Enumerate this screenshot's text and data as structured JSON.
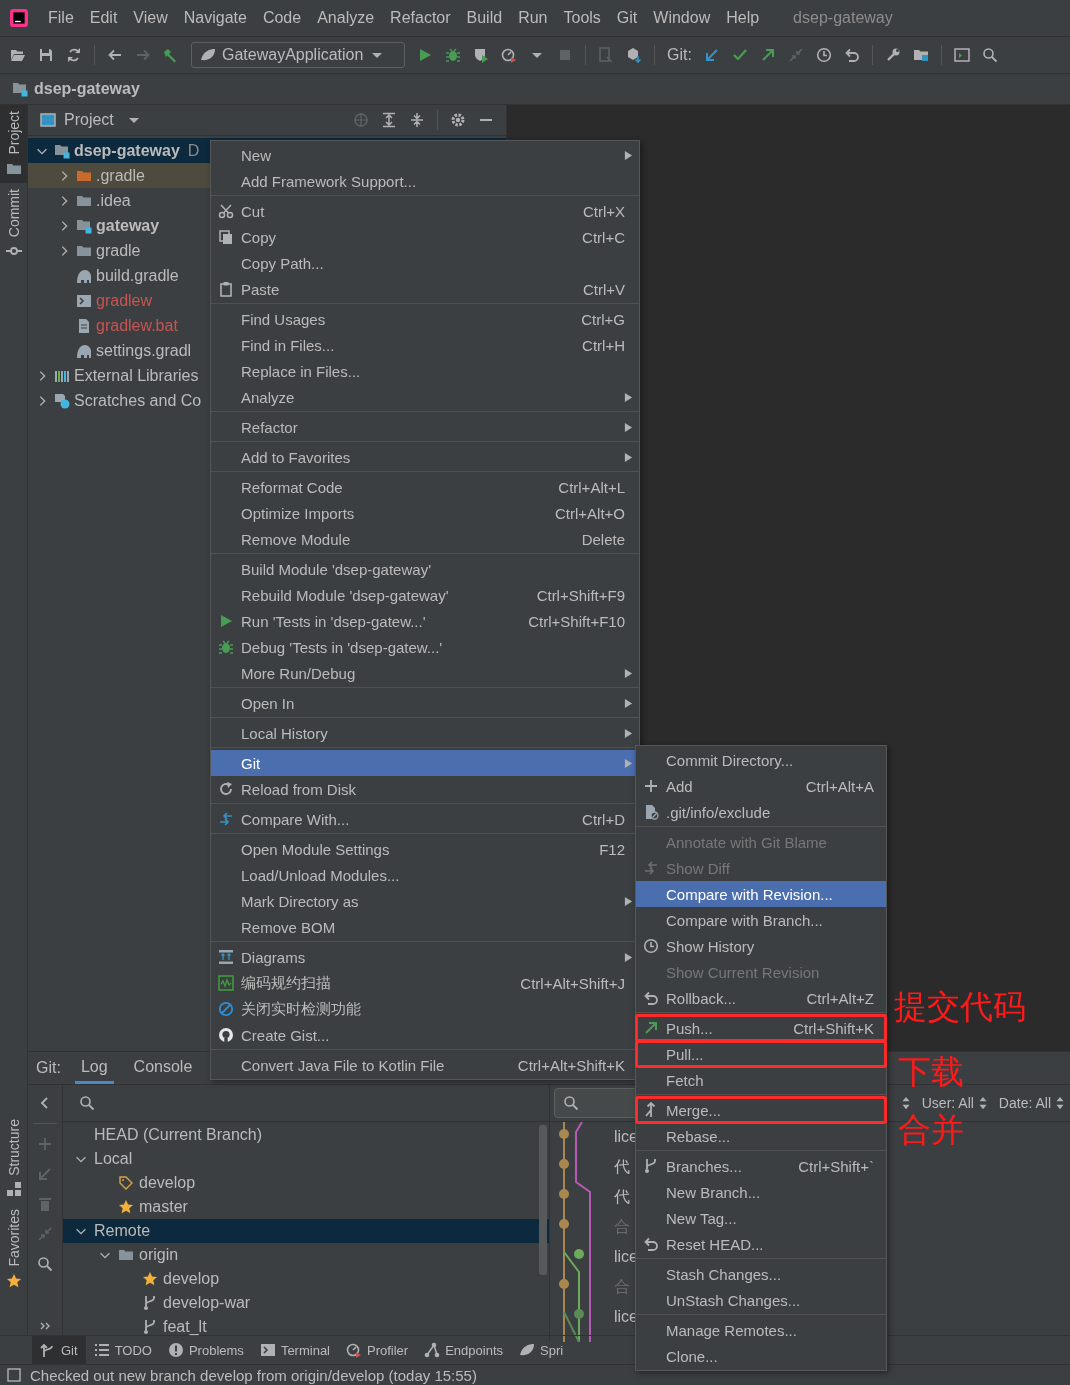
{
  "menu_bar": {
    "items": [
      "File",
      "Edit",
      "View",
      "Navigate",
      "Code",
      "Analyze",
      "Refactor",
      "Build",
      "Run",
      "Tools",
      "Git",
      "Window",
      "Help"
    ],
    "project_title": "dsep-gateway"
  },
  "toolbar": {
    "run_config": "GatewayApplication",
    "git_label": "Git:"
  },
  "nav_bar": {
    "project": "dsep-gateway"
  },
  "left_tabs_top": [
    {
      "label": "Project",
      "selected": true
    },
    {
      "label": "Commit",
      "selected": false
    }
  ],
  "left_tabs_bottom": [
    {
      "label": "Structure",
      "selected": false
    },
    {
      "label": "Favorites",
      "selected": false
    }
  ],
  "project_panel": {
    "title": "Project",
    "tree": [
      {
        "label": "dsep-gateway",
        "suffix": "D",
        "kind": "module",
        "bold": true,
        "expanded": true,
        "selected": true,
        "children": [
          {
            "label": ".gradle",
            "kind": "folder-orange",
            "expanded": false,
            "ignored": true
          },
          {
            "label": ".idea",
            "kind": "folder",
            "expanded": false
          },
          {
            "label": "gateway",
            "kind": "module",
            "bold": true,
            "expanded": false
          },
          {
            "label": "gradle",
            "kind": "folder",
            "expanded": false
          },
          {
            "label": "build.gradle",
            "kind": "gradle"
          },
          {
            "label": "gradlew",
            "kind": "script",
            "untracked": true
          },
          {
            "label": "gradlew.bat",
            "kind": "file",
            "untracked": true
          },
          {
            "label": "settings.gradl",
            "kind": "gradle"
          }
        ]
      },
      {
        "label": "External Libraries",
        "kind": "libraries",
        "expanded": false
      },
      {
        "label": "Scratches and Co",
        "kind": "scratches",
        "expanded": false
      }
    ]
  },
  "context_menu": {
    "groups": [
      [
        {
          "label": "New",
          "submenu": true,
          "selected": false
        },
        {
          "label": "Add Framework Support...",
          "selected": false
        }
      ],
      [
        {
          "label": "Cut",
          "shortcut": "Ctrl+X",
          "selected": false
        },
        {
          "label": "Copy",
          "shortcut": "Ctrl+C",
          "selected": false
        },
        {
          "label": "Copy Path...",
          "selected": false
        },
        {
          "label": "Paste",
          "shortcut": "Ctrl+V",
          "selected": false
        }
      ],
      [
        {
          "label": "Find Usages",
          "shortcut": "Ctrl+G",
          "selected": false
        },
        {
          "label": "Find in Files...",
          "shortcut": "Ctrl+H",
          "selected": false
        },
        {
          "label": "Replace in Files...",
          "selected": false
        },
        {
          "label": "Analyze",
          "submenu": true,
          "selected": false
        }
      ],
      [
        {
          "label": "Refactor",
          "submenu": true,
          "selected": false
        }
      ],
      [
        {
          "label": "Add to Favorites",
          "submenu": true,
          "selected": false
        }
      ],
      [
        {
          "label": "Reformat Code",
          "shortcut": "Ctrl+Alt+L",
          "selected": false
        },
        {
          "label": "Optimize Imports",
          "shortcut": "Ctrl+Alt+O",
          "selected": false
        },
        {
          "label": "Remove Module",
          "shortcut": "Delete",
          "selected": false
        }
      ],
      [
        {
          "label": "Build Module 'dsep-gateway'",
          "selected": false
        },
        {
          "label": "Rebuild Module 'dsep-gateway'",
          "shortcut": "Ctrl+Shift+F9",
          "selected": false
        },
        {
          "label": "Run 'Tests in 'dsep-gatew...'",
          "shortcut": "Ctrl+Shift+F10",
          "selected": false
        },
        {
          "label": "Debug 'Tests in 'dsep-gatew...'",
          "selected": false
        },
        {
          "label": "More Run/Debug",
          "submenu": true,
          "selected": false
        }
      ],
      [
        {
          "label": "Open In",
          "submenu": true,
          "selected": false
        }
      ],
      [
        {
          "label": "Local History",
          "submenu": true,
          "selected": false
        }
      ],
      [
        {
          "label": "Git",
          "submenu": true,
          "selected": true
        },
        {
          "label": "Reload from Disk",
          "selected": false
        }
      ],
      [
        {
          "label": "Compare With...",
          "shortcut": "Ctrl+D",
          "selected": false
        }
      ],
      [
        {
          "label": "Open Module Settings",
          "shortcut": "F12",
          "selected": false
        },
        {
          "label": "Load/Unload Modules...",
          "selected": false
        },
        {
          "label": "Mark Directory as",
          "submenu": true,
          "selected": false
        },
        {
          "label": "Remove BOM",
          "selected": false
        }
      ],
      [
        {
          "label": "Diagrams",
          "submenu": true,
          "selected": false
        },
        {
          "label": "编码规约扫描",
          "shortcut": "Ctrl+Alt+Shift+J",
          "selected": false
        },
        {
          "label": "关闭实时检测功能",
          "selected": false
        },
        {
          "label": "Create Gist...",
          "selected": false
        }
      ],
      [
        {
          "label": "Convert Java File to Kotlin File",
          "shortcut": "Ctrl+Alt+Shift+K",
          "selected": false
        }
      ]
    ]
  },
  "git_submenu": {
    "groups": [
      [
        {
          "label": "Commit Directory...",
          "selected": false,
          "disabled": false,
          "highlighted": false
        },
        {
          "label": "Add",
          "shortcut": "Ctrl+Alt+A",
          "selected": false,
          "disabled": false,
          "highlighted": false
        },
        {
          "label": ".git/info/exclude",
          "selected": false,
          "disabled": false,
          "highlighted": false
        }
      ],
      [
        {
          "label": "Annotate with Git Blame",
          "selected": false,
          "disabled": true,
          "highlighted": false
        },
        {
          "label": "Show Diff",
          "selected": false,
          "disabled": true,
          "highlighted": false
        },
        {
          "label": "Compare with Revision...",
          "selected": true,
          "disabled": false,
          "highlighted": false
        },
        {
          "label": "Compare with Branch...",
          "selected": false,
          "disabled": false,
          "highlighted": false
        },
        {
          "label": "Show History",
          "selected": false,
          "disabled": false,
          "highlighted": false
        },
        {
          "label": "Show Current Revision",
          "selected": false,
          "disabled": true,
          "highlighted": false
        },
        {
          "label": "Rollback...",
          "shortcut": "Ctrl+Alt+Z",
          "selected": false,
          "disabled": false,
          "highlighted": false
        }
      ],
      [
        {
          "label": "Push...",
          "shortcut": "Ctrl+Shift+K",
          "selected": false,
          "disabled": false,
          "highlighted": true
        },
        {
          "label": "Pull...",
          "selected": false,
          "disabled": false,
          "highlighted": true
        },
        {
          "label": "Fetch",
          "selected": false,
          "disabled": false,
          "highlighted": false
        }
      ],
      [
        {
          "label": "Merge...",
          "selected": false,
          "disabled": false,
          "highlighted": true
        },
        {
          "label": "Rebase...",
          "selected": false,
          "disabled": false,
          "highlighted": false
        }
      ],
      [
        {
          "label": "Branches...",
          "shortcut": "Ctrl+Shift+`",
          "selected": false,
          "disabled": false,
          "highlighted": false
        },
        {
          "label": "New Branch...",
          "selected": false,
          "disabled": false,
          "highlighted": false
        },
        {
          "label": "New Tag...",
          "selected": false,
          "disabled": false,
          "highlighted": false
        },
        {
          "label": "Reset HEAD...",
          "selected": false,
          "disabled": false,
          "highlighted": false
        }
      ],
      [
        {
          "label": "Stash Changes...",
          "selected": false,
          "disabled": false,
          "highlighted": false
        },
        {
          "label": "UnStash Changes...",
          "selected": false,
          "disabled": false,
          "highlighted": false
        }
      ],
      [
        {
          "label": "Manage Remotes...",
          "selected": false,
          "disabled": false,
          "highlighted": false
        },
        {
          "label": "Clone...",
          "selected": false,
          "disabled": false,
          "highlighted": false
        }
      ]
    ]
  },
  "annotations": [
    {
      "text": "提交代码"
    },
    {
      "text": "下载"
    },
    {
      "text": "合并"
    }
  ],
  "git_panel": {
    "label": "Git:",
    "tabs": [
      {
        "label": "Log",
        "selected": true
      },
      {
        "label": "Console",
        "selected": false
      }
    ],
    "branches": [
      {
        "label": "HEAD (Current Branch)",
        "selected": false
      },
      {
        "label": "Local",
        "expanded": true,
        "selected": false,
        "children": [
          {
            "label": "develop",
            "kind": "tag",
            "selected": false
          },
          {
            "label": "master",
            "kind": "star",
            "selected": false
          }
        ]
      },
      {
        "label": "Remote",
        "expanded": true,
        "selected": true,
        "children": [
          {
            "label": "origin",
            "kind": "folder",
            "expanded": true,
            "selected": false,
            "children": [
              {
                "label": "develop",
                "kind": "star",
                "selected": false
              },
              {
                "label": "develop-war",
                "kind": "branch",
                "selected": false
              },
              {
                "label": "feat_lt",
                "kind": "branch",
                "selected": false
              }
            ]
          }
        ]
      }
    ],
    "log_messages": [
      {
        "text": "lice",
        "dim": false
      },
      {
        "text": "代",
        "dim": false
      },
      {
        "text": "代",
        "dim": false
      },
      {
        "text": "合",
        "dim": true
      },
      {
        "text": "lice",
        "dim": false
      },
      {
        "text": "合",
        "dim": true
      },
      {
        "text": "lice",
        "dim": false
      }
    ],
    "filters": [
      {
        "label": "User: All"
      },
      {
        "label": "Date: All"
      }
    ]
  },
  "tool_windows": [
    {
      "label": "Git",
      "selected": true
    },
    {
      "label": "TODO",
      "selected": false
    },
    {
      "label": "Problems",
      "selected": false
    },
    {
      "label": "Terminal",
      "selected": false
    },
    {
      "label": "Profiler",
      "selected": false
    },
    {
      "label": "Endpoints",
      "selected": false
    },
    {
      "label": "Spri",
      "selected": false
    }
  ],
  "status_bar": {
    "message": "Checked out new branch develop from origin/develop (today 15:55)"
  }
}
